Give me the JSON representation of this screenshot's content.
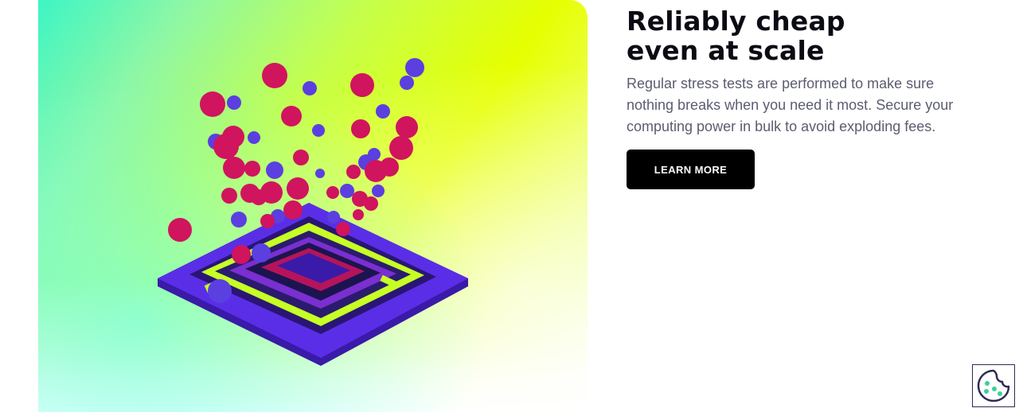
{
  "feature": {
    "title_line1": "Reliably cheap",
    "title_line2": "even at scale",
    "description": "Regular stress tests are performed to make sure nothing breaks when you need it most. Secure your computing power in bulk to avoid exploding fees.",
    "cta_label": "LEARN MORE"
  },
  "illustration": {
    "subject": "exploding-cpu-chip",
    "colors": {
      "chip": "#5a2ee6",
      "chip_dark": "#3a1aa8",
      "socket_accent": "#c6ff24",
      "bubble_red": "#d0145e",
      "bubble_blue": "#5b3fe0"
    }
  },
  "cookie_settings": {
    "icon": "cookie-icon"
  }
}
